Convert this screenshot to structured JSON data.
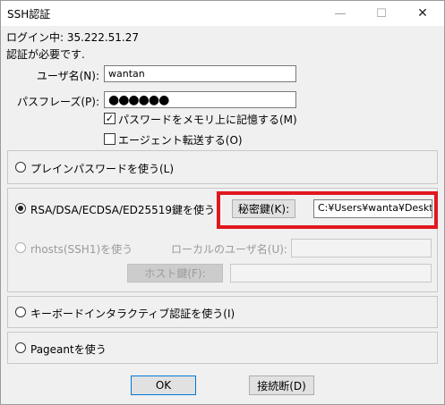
{
  "window": {
    "title": "SSH認証",
    "minimize_icon": "minimize-icon",
    "maximize_icon": "maximize-icon",
    "close_icon": "close-icon"
  },
  "login_line": "ログイン中: 35.222.51.27",
  "auth_required": "認証が必要です.",
  "username": {
    "label": "ユーザ名(N):",
    "value": "wantan"
  },
  "passphrase": {
    "label": "パスフレーズ(P):",
    "value": "●●●●●●"
  },
  "remember_password": {
    "label": "パスワードをメモリ上に記憶する(M)",
    "checked": true
  },
  "agent_forwarding": {
    "label": "エージェント転送する(O)",
    "checked": false
  },
  "options": {
    "plain_password": "プレインパスワードを使う(L)",
    "rsa_key": "RSA/DSA/ECDSA/ED25519鍵を使う",
    "rhosts": "rhosts(SSH1)を使う",
    "keyboard_interactive": "キーボードインタラクティブ認証を使う(I)",
    "pageant": "Pageantを使う"
  },
  "selected_option": "rsa_key",
  "private_key": {
    "button_label": "秘密鍵(K):",
    "path": "C:¥Users¥wanta¥Desktop"
  },
  "local_user": {
    "label": "ローカルのユーザ名(U):",
    "value": ""
  },
  "host_key": {
    "button_label": "ホスト鍵(F):",
    "value": ""
  },
  "buttons": {
    "ok": "OK",
    "disconnect": "接続断(D)"
  },
  "colors": {
    "highlight": "#e0181e",
    "default_button_border": "#0078d7"
  }
}
